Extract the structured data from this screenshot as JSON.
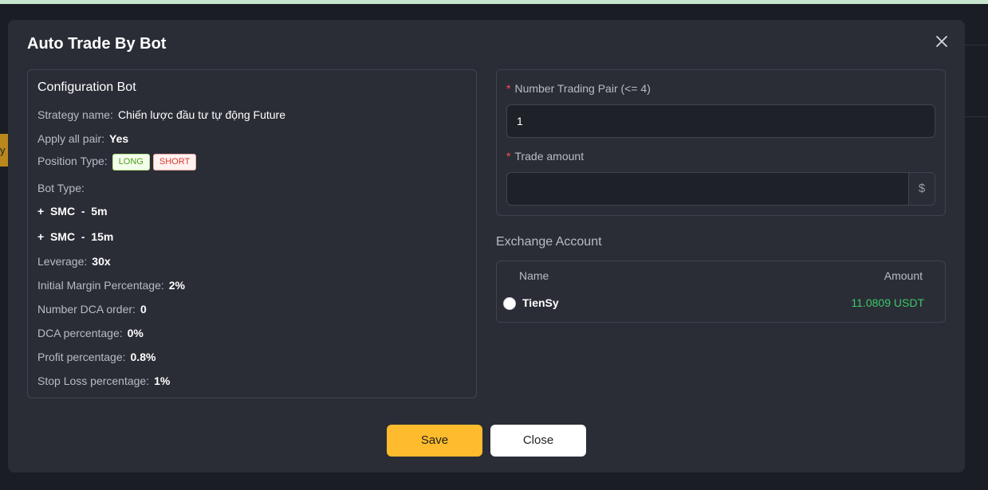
{
  "edge_tab_text": "y",
  "modal": {
    "title": "Auto Trade By Bot"
  },
  "config": {
    "title": "Configuration Bot",
    "strategy_label": "Strategy name:",
    "strategy_value": "Chiến lược đầu tư tự động Future",
    "apply_label": "Apply all pair:",
    "apply_value": "Yes",
    "position_label": "Position Type:",
    "position_long": "LONG",
    "position_short": "SHORT",
    "bot_type_label": "Bot Type:",
    "bot_items": [
      "+  SMC  -  5m",
      "+  SMC  -  15m"
    ],
    "leverage_label": "Leverage:",
    "leverage_value": "30x",
    "initial_margin_label": "Initial Margin Percentage:",
    "initial_margin_value": "2%",
    "dca_order_label": "Number DCA order:",
    "dca_order_value": "0",
    "dca_pct_label": "DCA percentage:",
    "dca_pct_value": "0%",
    "profit_label": "Profit percentage:",
    "profit_value": "0.8%",
    "stoploss_label": "Stop Loss percentage:",
    "stoploss_value": "1%"
  },
  "form": {
    "pair_label": "Number Trading Pair (<= 4)",
    "pair_value": "1",
    "amount_label": "Trade amount",
    "amount_value": "",
    "amount_suffix": "$",
    "required_mark": "*"
  },
  "exchange": {
    "label": "Exchange Account",
    "col_name": "Name",
    "col_amount": "Amount",
    "accounts": [
      {
        "name": "TienSy",
        "amount": "11.0809 USDT"
      }
    ]
  },
  "buttons": {
    "save": "Save",
    "close": "Close"
  },
  "colors": {
    "accent": "#fdbb2d",
    "positive": "#3cc86a",
    "required": "#ff4d4f"
  }
}
